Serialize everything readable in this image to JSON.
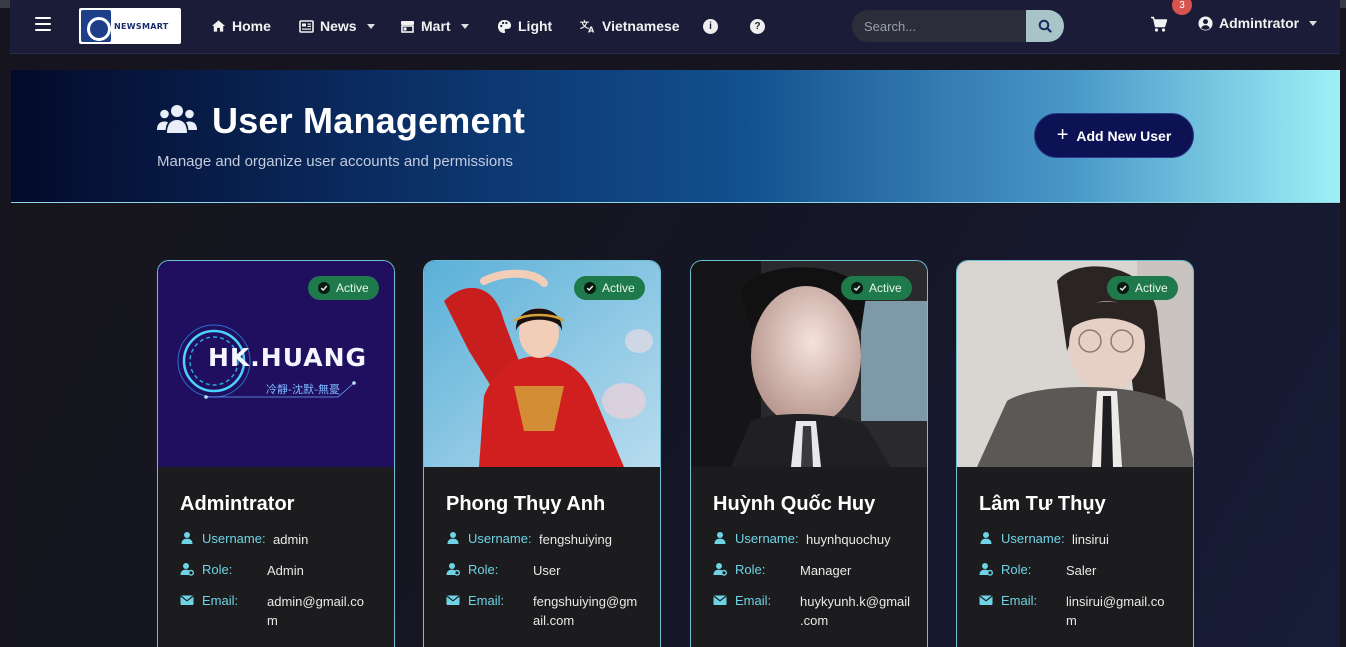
{
  "nav": {
    "items": [
      {
        "label": "Home",
        "icon": "home-icon"
      },
      {
        "label": "News",
        "icon": "newspaper-icon"
      },
      {
        "label": "Mart",
        "icon": "store-icon"
      },
      {
        "label": "Light",
        "icon": "palette-icon"
      },
      {
        "label": "Vietnamese",
        "icon": "language-icon"
      }
    ],
    "search_placeholder": "Search...",
    "cart_count": "3",
    "account_label": "Admintrator"
  },
  "hero": {
    "title": "User Management",
    "subtitle": "Manage and organize user accounts and permissions",
    "add_button": "Add New User"
  },
  "labels": {
    "username": "Username:",
    "role": "Role:",
    "email": "Email:"
  },
  "users": [
    {
      "name": "Admintrator",
      "status": "Active",
      "username": "admin",
      "role": "Admin",
      "email_line1": "admin@gmail.co",
      "email_line2": "m",
      "photo": "HK.HUANG logo",
      "logo_text": "HK.HUANG",
      "logo_sub": "冷靜-沈默-無憂"
    },
    {
      "name": "Phong Thụy Anh",
      "status": "Active",
      "username": "fengshuiying",
      "role": "User",
      "email_line1": "fengshuiying@gm",
      "email_line2": "ail.com",
      "photo": "woman in red dress"
    },
    {
      "name": "Huỳnh Quốc Huy",
      "status": "Active",
      "username": "huynhquochuy",
      "role": "Manager",
      "email_line1": "huykyunh.k@gmail",
      "email_line2": ".com",
      "photo": "man in suit"
    },
    {
      "name": "Lâm Tư Thụy",
      "status": "Active",
      "username": "linsirui",
      "role": "Saler",
      "email_line1": "linsirui@gmail.co",
      "email_line2": "m",
      "photo": "woman with glasses"
    }
  ],
  "colors": {
    "navbar": "#1b1d38",
    "accent_cyan": "#6fd3e6",
    "status_green": "#1f7a4b",
    "add_button": "#0c1253"
  }
}
